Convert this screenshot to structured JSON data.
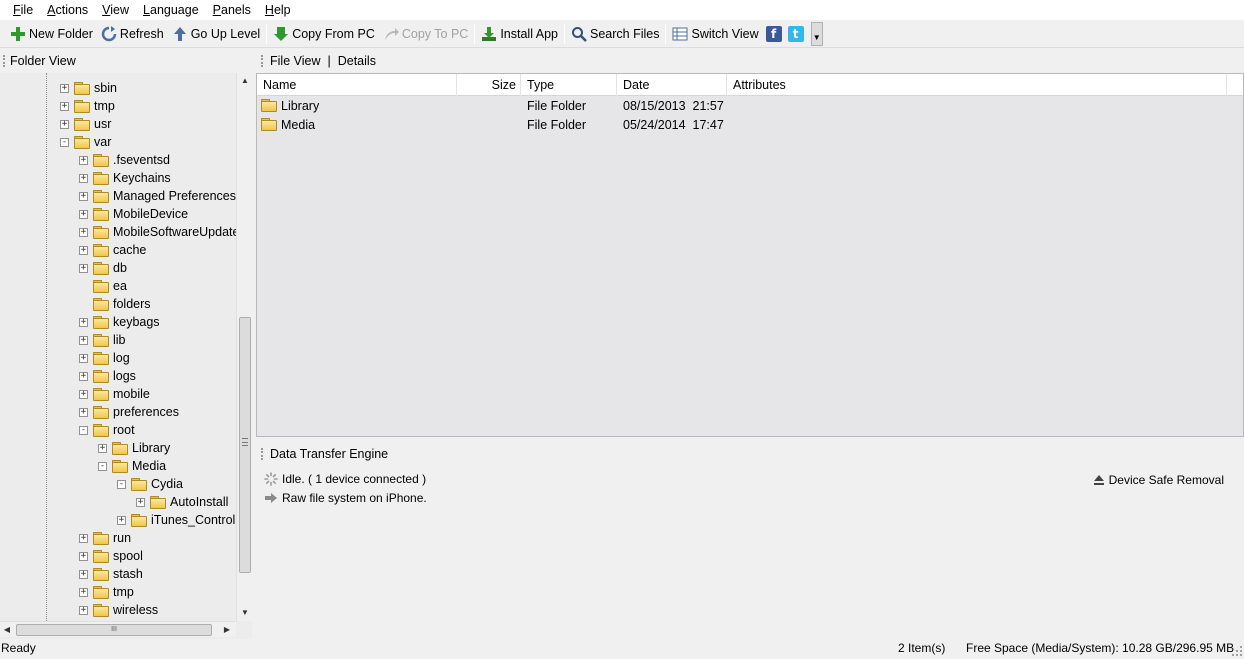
{
  "menu": [
    {
      "label": "File",
      "underline": "F",
      "rest": "ile"
    },
    {
      "label": "Actions",
      "underline": "A",
      "rest": "ctions"
    },
    {
      "label": "View",
      "underline": "V",
      "rest": "iew"
    },
    {
      "label": "Language",
      "underline": "L",
      "rest": "anguage"
    },
    {
      "label": "Panels",
      "underline": "P",
      "rest": "anels"
    },
    {
      "label": "Help",
      "underline": "H",
      "rest": "elp"
    }
  ],
  "toolbar": {
    "new_folder": "New Folder",
    "refresh": "Refresh",
    "go_up": "Go Up Level",
    "copy_from_pc": "Copy From PC",
    "copy_to_pc": "Copy To PC",
    "install_app": "Install App",
    "search_files": "Search Files",
    "switch_view": "Switch View",
    "facebook_glyph": "f",
    "twitter_glyph": "t"
  },
  "folder_view": {
    "title": "Folder View",
    "scroll_grip": "III",
    "tree": [
      {
        "label": "sbin",
        "level": 0,
        "expander": "+"
      },
      {
        "label": "tmp",
        "level": 0,
        "expander": "+"
      },
      {
        "label": "usr",
        "level": 0,
        "expander": "+"
      },
      {
        "label": "var",
        "level": 0,
        "expander": "-"
      },
      {
        "label": ".fseventsd",
        "level": 1,
        "expander": "+"
      },
      {
        "label": "Keychains",
        "level": 1,
        "expander": "+"
      },
      {
        "label": "Managed Preferences",
        "level": 1,
        "expander": "+"
      },
      {
        "label": "MobileDevice",
        "level": 1,
        "expander": "+"
      },
      {
        "label": "MobileSoftwareUpdate",
        "level": 1,
        "expander": "+"
      },
      {
        "label": "cache",
        "level": 1,
        "expander": "+"
      },
      {
        "label": "db",
        "level": 1,
        "expander": "+"
      },
      {
        "label": "ea",
        "level": 1,
        "expander": ""
      },
      {
        "label": "folders",
        "level": 1,
        "expander": ""
      },
      {
        "label": "keybags",
        "level": 1,
        "expander": "+"
      },
      {
        "label": "lib",
        "level": 1,
        "expander": "+"
      },
      {
        "label": "log",
        "level": 1,
        "expander": "+"
      },
      {
        "label": "logs",
        "level": 1,
        "expander": "+"
      },
      {
        "label": "mobile",
        "level": 1,
        "expander": "+"
      },
      {
        "label": "preferences",
        "level": 1,
        "expander": "+"
      },
      {
        "label": "root",
        "level": 1,
        "expander": "-"
      },
      {
        "label": "Library",
        "level": 2,
        "expander": "+"
      },
      {
        "label": "Media",
        "level": 2,
        "expander": "-"
      },
      {
        "label": "Cydia",
        "level": 3,
        "expander": "-"
      },
      {
        "label": "AutoInstall",
        "level": 4,
        "expander": "+"
      },
      {
        "label": "iTunes_Control",
        "level": 3,
        "expander": "+"
      },
      {
        "label": "run",
        "level": 1,
        "expander": "+"
      },
      {
        "label": "spool",
        "level": 1,
        "expander": "+"
      },
      {
        "label": "stash",
        "level": 1,
        "expander": "+"
      },
      {
        "label": "tmp",
        "level": 1,
        "expander": "+"
      },
      {
        "label": "wireless",
        "level": 1,
        "expander": "+"
      }
    ]
  },
  "file_view": {
    "tab_file_view": "File View",
    "separator": "|",
    "tab_details": "Details",
    "columns": {
      "name": "Name",
      "size": "Size",
      "type": "Type",
      "date": "Date",
      "attributes": "Attributes"
    },
    "rows": [
      {
        "name": "Library",
        "size": "",
        "type": "File Folder",
        "date": "08/15/2013  21:57",
        "attributes": ""
      },
      {
        "name": "Media",
        "size": "",
        "type": "File Folder",
        "date": "05/24/2014  17:47",
        "attributes": ""
      }
    ]
  },
  "transfer": {
    "title": "Data Transfer Engine",
    "status": "Idle. ( 1 device connected )",
    "mode": "Raw file system on iPhone.",
    "safe_removal": "Device Safe Removal"
  },
  "statusbar": {
    "ready": "Ready",
    "items": "2 Item(s)",
    "space": "Free Space (Media/System): 10.28 GB/296.95 MB"
  },
  "colors": {
    "accent_green": "#2e9a2e",
    "facebook": "#3b5998",
    "twitter": "#33b6e8",
    "folder_yellow": "#f1c64a"
  }
}
